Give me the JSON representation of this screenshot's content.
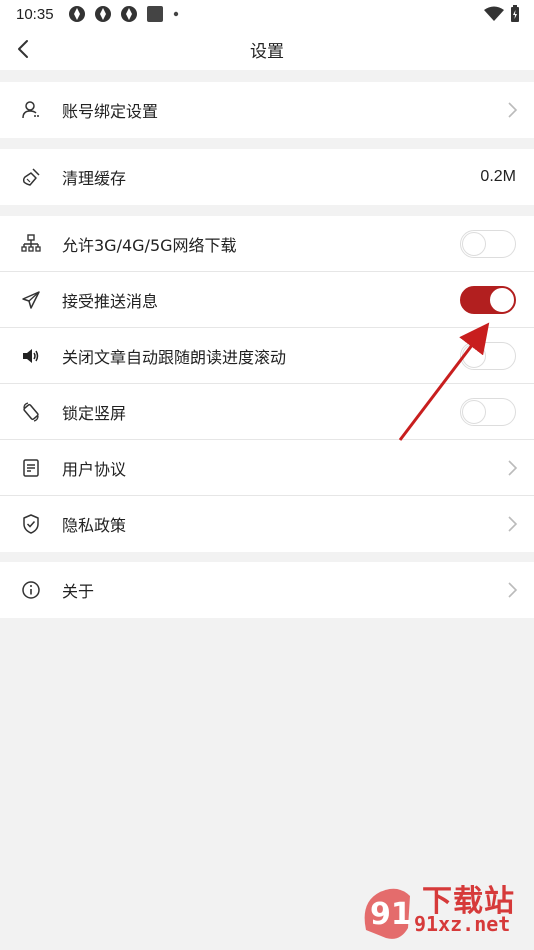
{
  "status_bar": {
    "time": "10:35"
  },
  "header": {
    "title": "设置"
  },
  "groups": [
    {
      "items": [
        {
          "label": "账号绑定设置",
          "icon": "user-icon",
          "control": "chevron"
        }
      ]
    },
    {
      "items": [
        {
          "label": "清理缓存",
          "icon": "broom-icon",
          "control": "value",
          "value": "0.2M"
        }
      ]
    },
    {
      "items": [
        {
          "label": "允许3G/4G/5G网络下载",
          "icon": "network-icon",
          "control": "toggle",
          "on": false
        },
        {
          "label": "接受推送消息",
          "icon": "send-icon",
          "control": "toggle",
          "on": true
        },
        {
          "label": "关闭文章自动跟随朗读进度滚动",
          "icon": "speaker-icon",
          "control": "toggle",
          "on": false
        },
        {
          "label": "锁定竖屏",
          "icon": "rotate-lock-icon",
          "control": "toggle",
          "on": false
        },
        {
          "label": "用户协议",
          "icon": "document-icon",
          "control": "chevron"
        },
        {
          "label": "隐私政策",
          "icon": "shield-icon",
          "control": "chevron"
        }
      ]
    },
    {
      "items": [
        {
          "label": "关于",
          "icon": "info-icon",
          "control": "chevron"
        }
      ]
    }
  ],
  "colors": {
    "accent": "#b21f1f",
    "background": "#f2f2f2",
    "watermark": "#d63a3a"
  },
  "watermark": {
    "logo_text": "91",
    "line1": "下载站",
    "line2": "91xz.net"
  }
}
